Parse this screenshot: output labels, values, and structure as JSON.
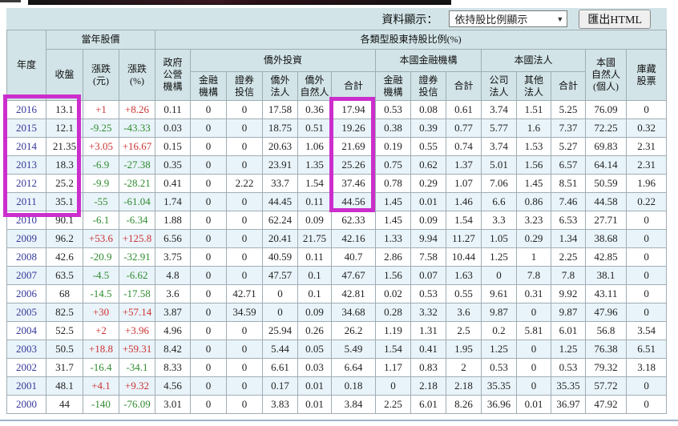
{
  "toolbar": {
    "display_label": "資料顯示：",
    "display_select_value": "依持股比例顯示",
    "select_arrow": "▼",
    "export_button_label": "匯出HTML"
  },
  "table": {
    "headers": {
      "year": "年度",
      "price_group": "當年股價",
      "close": "收盤",
      "change_amount": "漲跌\n(元)",
      "change_percent": "漲跌\n(%)",
      "ratio_group": "各類型股東持股比例(%)",
      "gov": "政府\n公營\n機構",
      "foreign_group": "僑外投資",
      "domestic_fi_group": "本國金融機構",
      "domestic_corp_group": "本國法人",
      "individual": "本國\n自然人\n(個人)",
      "treasury": "庫藏\n股票",
      "sub": [
        "金融\n機構",
        "證券\n投信",
        "僑外\n法人",
        "僑外\n自然人",
        "合計",
        "金融\n機構",
        "證券\n投信",
        "合計",
        "公司\n法人",
        "其他\n法人",
        "合計"
      ]
    },
    "rows": [
      {
        "year": "2016",
        "values": [
          "13.1",
          "+1",
          "+8.26",
          "0.11",
          "0",
          "0",
          "17.58",
          "0.36",
          "17.94",
          "0.53",
          "0.08",
          "0.61",
          "3.74",
          "1.51",
          "5.25",
          "76.09",
          "0"
        ]
      },
      {
        "year": "2015",
        "values": [
          "12.1",
          "-9.25",
          "-43.33",
          "0.03",
          "0",
          "0",
          "18.75",
          "0.51",
          "19.26",
          "0.38",
          "0.39",
          "0.77",
          "5.77",
          "1.6",
          "7.37",
          "72.25",
          "0.32"
        ]
      },
      {
        "year": "2014",
        "values": [
          "21.35",
          "+3.05",
          "+16.67",
          "0.15",
          "0",
          "0",
          "20.63",
          "1.06",
          "21.69",
          "0.19",
          "0.55",
          "0.74",
          "3.74",
          "1.53",
          "5.27",
          "69.83",
          "2.31"
        ]
      },
      {
        "year": "2013",
        "values": [
          "18.3",
          "-6.9",
          "-27.38",
          "0.35",
          "0",
          "0",
          "23.91",
          "1.35",
          "25.26",
          "0.75",
          "0.62",
          "1.37",
          "5.01",
          "1.56",
          "6.57",
          "64.14",
          "2.31"
        ]
      },
      {
        "year": "2012",
        "values": [
          "25.2",
          "-9.9",
          "-28.21",
          "0.41",
          "0",
          "2.22",
          "33.7",
          "1.54",
          "37.46",
          "0.78",
          "0.29",
          "1.07",
          "7.06",
          "1.45",
          "8.51",
          "50.59",
          "1.96"
        ]
      },
      {
        "year": "2011",
        "values": [
          "35.1",
          "-55",
          "-61.04",
          "1.74",
          "0",
          "0",
          "44.45",
          "0.11",
          "44.56",
          "1.45",
          "0.01",
          "1.46",
          "6.6",
          "0.86",
          "7.46",
          "44.58",
          "0.22"
        ]
      },
      {
        "year": "2010",
        "values": [
          "90.1",
          "-6.1",
          "-6.34",
          "1.88",
          "0",
          "0",
          "62.24",
          "0.09",
          "62.33",
          "1.45",
          "0.09",
          "1.54",
          "3.3",
          "3.23",
          "6.53",
          "27.71",
          "0"
        ]
      },
      {
        "year": "2009",
        "values": [
          "96.2",
          "+53.6",
          "+125.8",
          "6.56",
          "0",
          "0",
          "20.41",
          "21.75",
          "42.16",
          "1.33",
          "9.94",
          "11.27",
          "1.05",
          "0.29",
          "1.34",
          "38.68",
          "0"
        ]
      },
      {
        "year": "2008",
        "values": [
          "42.6",
          "-20.9",
          "-32.91",
          "3.75",
          "0",
          "0",
          "40.59",
          "0.11",
          "40.7",
          "2.86",
          "7.58",
          "10.44",
          "1.25",
          "1",
          "2.25",
          "42.85",
          "0"
        ]
      },
      {
        "year": "2007",
        "values": [
          "63.5",
          "-4.5",
          "-6.62",
          "4.8",
          "0",
          "0",
          "47.57",
          "0.1",
          "47.67",
          "1.56",
          "0.07",
          "1.63",
          "0",
          "7.8",
          "7.8",
          "38.1",
          "0"
        ]
      },
      {
        "year": "2006",
        "values": [
          "68",
          "-14.5",
          "-17.58",
          "3.6",
          "0",
          "42.71",
          "0",
          "0.1",
          "42.81",
          "0.02",
          "0.53",
          "0.55",
          "9.61",
          "0.31",
          "9.92",
          "43.11",
          "0"
        ]
      },
      {
        "year": "2005",
        "values": [
          "82.5",
          "+30",
          "+57.14",
          "3.87",
          "0",
          "34.59",
          "0",
          "0.09",
          "34.68",
          "0.28",
          "3.32",
          "3.6",
          "9.87",
          "0",
          "9.87",
          "47.96",
          "0"
        ]
      },
      {
        "year": "2004",
        "values": [
          "52.5",
          "+2",
          "+3.96",
          "4.96",
          "0",
          "0",
          "25.94",
          "0.26",
          "26.2",
          "1.19",
          "1.31",
          "2.5",
          "0.2",
          "5.81",
          "6.01",
          "56.8",
          "3.54"
        ]
      },
      {
        "year": "2003",
        "values": [
          "50.5",
          "+18.8",
          "+59.31",
          "8.42",
          "0",
          "0",
          "5.44",
          "0.05",
          "5.49",
          "1.54",
          "0.41",
          "1.95",
          "1.25",
          "0",
          "1.25",
          "76.38",
          "6.51"
        ]
      },
      {
        "year": "2002",
        "values": [
          "31.7",
          "-16.4",
          "-34.1",
          "8.33",
          "0",
          "0",
          "6.61",
          "0.03",
          "6.64",
          "1.17",
          "0.83",
          "2",
          "0.53",
          "0",
          "0.53",
          "79.32",
          "3.18"
        ]
      },
      {
        "year": "2001",
        "values": [
          "48.1",
          "+4.1",
          "+9.32",
          "4.56",
          "0",
          "0",
          "0.17",
          "0.01",
          "0.18",
          "0",
          "2.18",
          "2.18",
          "35.35",
          "0",
          "35.35",
          "57.72",
          "0"
        ]
      },
      {
        "year": "2000",
        "values": [
          "44",
          "-140",
          "-76.09",
          "3.01",
          "0",
          "0",
          "3.83",
          "0.01",
          "3.84",
          "2.25",
          "6.01",
          "8.26",
          "36.96",
          "0.01",
          "36.97",
          "47.92",
          "0"
        ]
      }
    ]
  },
  "colors": {
    "header_bg": "#d2e4e8",
    "alt_row_bg": "#e9f4fa",
    "year_text": "#35389a",
    "positive": "#cc3333",
    "negative": "#2e8b2e",
    "highlight": "#cc2ecc"
  }
}
